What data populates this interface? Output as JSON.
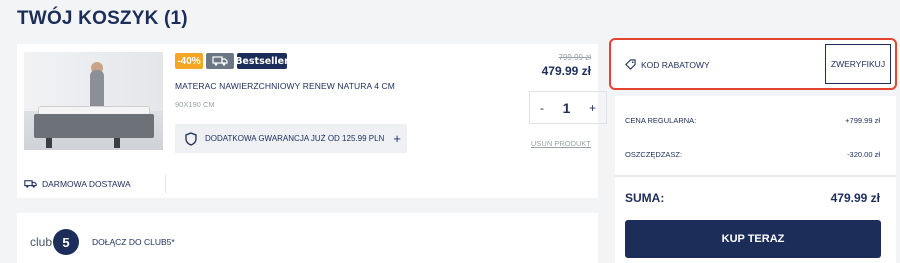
{
  "page": {
    "title": "TWÓJ KOSZYK (1)"
  },
  "product": {
    "badges": {
      "discount": "-40%",
      "truck_icon": "truck-icon",
      "bestseller": "Bestseller"
    },
    "name": "MATERAC NAWIERZCHNIOWY RENEW NATURA 4 CM",
    "size": "90X190 CM",
    "old_price": "799.99 zł",
    "new_price": "479.99 zł",
    "quantity": {
      "minus": "-",
      "value": "1",
      "plus": "+"
    },
    "remove_label": "USUŃ PRODUKT",
    "warranty": {
      "label": "DODATKOWA GWARANCJA JUŻ OD 125.99 PLN",
      "plus": "+"
    },
    "delivery": "DARMOWA DOSTAWA"
  },
  "club": {
    "logo_text": "club",
    "logo_number": "5",
    "label": "DOŁĄCZ DO CLUB5*"
  },
  "coupon": {
    "label": "KOD RABATOWY",
    "button": "ZWERYFIKUJ"
  },
  "summary": {
    "regular_label": "CENA REGULARNA:",
    "regular_value": "+799.99 zł",
    "savings_label": "OSZCZĘDZASZ:",
    "savings_value": "-320.00 zł",
    "total_label": "SUMA:",
    "total_value": "479.99 zł",
    "buy_button": "KUP TERAZ"
  },
  "colors": {
    "navy": "#1c2d5a",
    "orange": "#f5a623",
    "highlight": "#e44530"
  }
}
